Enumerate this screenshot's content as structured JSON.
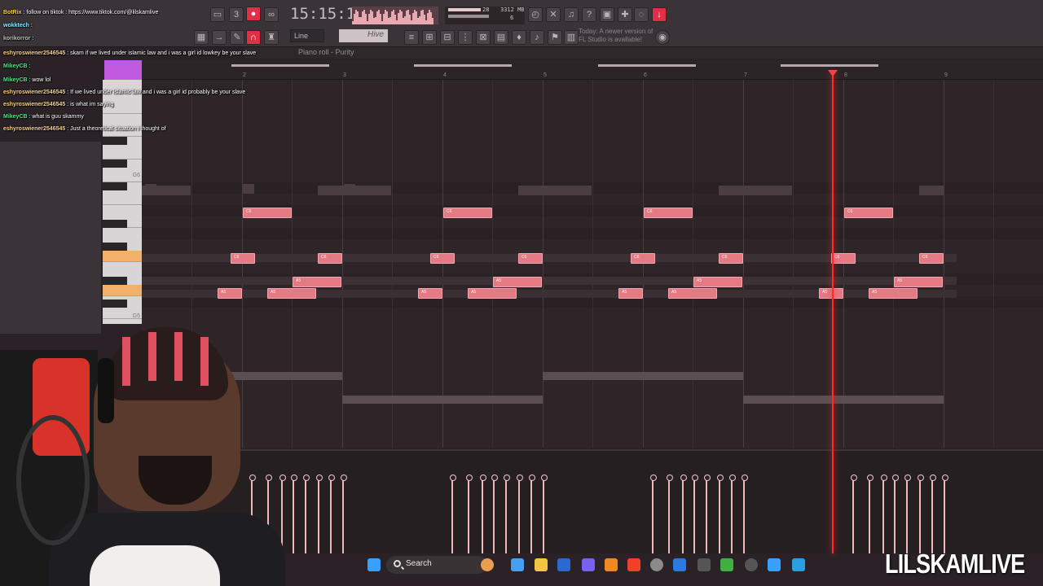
{
  "toolbar": {
    "clock": "15:15:13",
    "snap": "Line",
    "pattern": "Hive",
    "cpu_top": "28",
    "memory": "3312 MB",
    "cpu_bottom": "6",
    "update_note": "Today: A newer version of FL Studio is available!"
  },
  "piano_roll": {
    "title": "Piano roll - Purity",
    "bar_numbers": [
      "2",
      "3",
      "4",
      "5",
      "6",
      "7",
      "8",
      "9"
    ],
    "key_labels": [
      "G6",
      "G5"
    ],
    "note_labels": [
      "C6",
      "C6",
      "A5",
      "A5"
    ]
  },
  "chat": {
    "messages": [
      {
        "user": "BotRix",
        "text": "follow on tiktok : https://www.tiktok.com/@lilskamlive"
      },
      {
        "user": "wokktech",
        "text": ""
      },
      {
        "user": "korikorror",
        "text": ""
      },
      {
        "user": "eshyroswiener2546545",
        "text": "skam if we lived under islamic law and i was a girl id lowkey be your slave"
      },
      {
        "user": "MikeyCB",
        "text": ""
      },
      {
        "user": "MikeyCB",
        "text": "wow lol"
      },
      {
        "user": "eshyroswiener2546545",
        "text": "If we lived under islamic law and i was a girl id probably be your slave"
      },
      {
        "user": "eshyroswiener2546545",
        "text": "is what im saying"
      },
      {
        "user": "MikeyCB",
        "text": "what is guu skammy"
      },
      {
        "user": "eshyroswiener2546545",
        "text": "Just a theoretical situation i thought of"
      }
    ]
  },
  "taskbar": {
    "search_label": "Search"
  },
  "watermark": "LILSKAMLIVE",
  "colors": {
    "note": "#e47a84",
    "playhead": "#ff2a2a",
    "accent": "#c05ae0",
    "key_highlight": "#f2b06a"
  },
  "icons": [
    "windows-start-icon",
    "search-icon",
    "chrome-icon",
    "file-explorer-icon",
    "discord-icon",
    "fl-studio-icon",
    "brave-icon",
    "steam-icon",
    "notepad-icon"
  ]
}
